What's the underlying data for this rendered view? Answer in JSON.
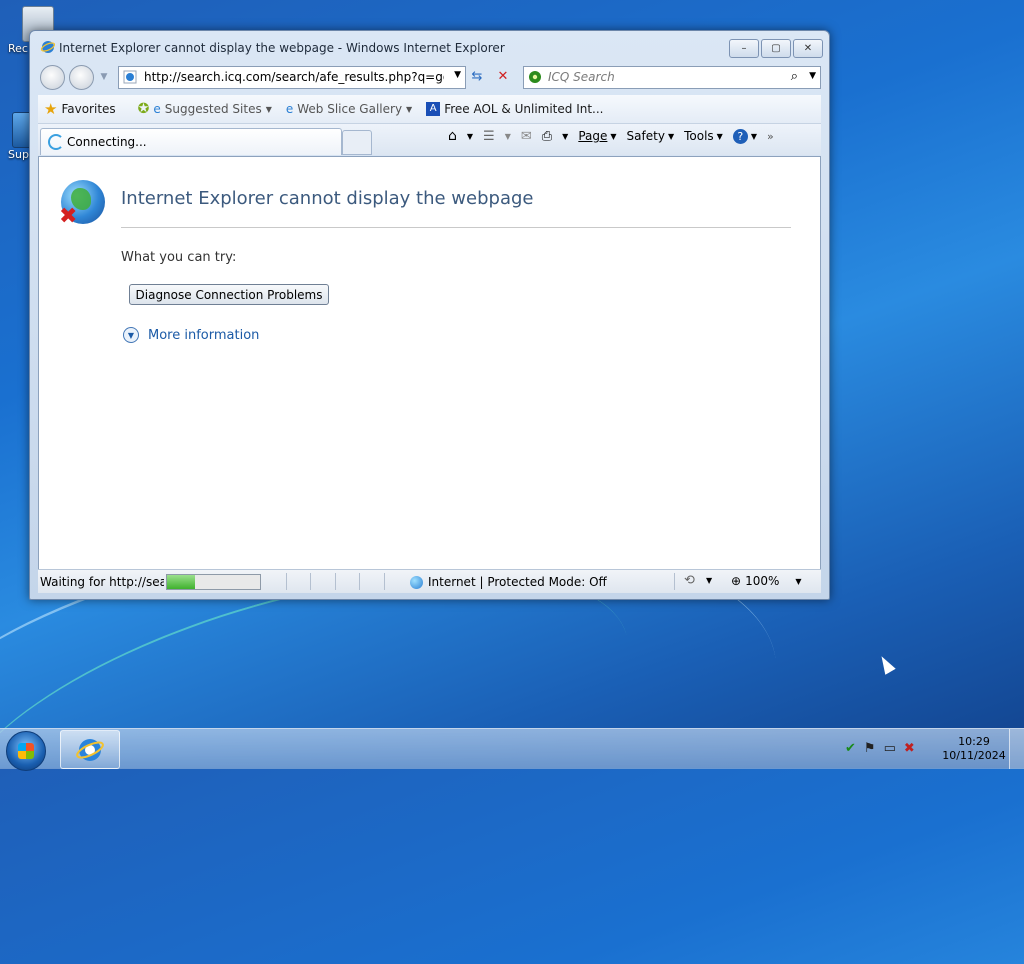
{
  "desktop": {
    "icons": [
      {
        "label": "Rec",
        "icon": "recycle-bin-icon"
      },
      {
        "label": "Sup",
        "icon": "shortcut-icon"
      }
    ]
  },
  "window": {
    "title": "Internet Explorer cannot display the webpage - Windows Internet Explorer",
    "caption": {
      "minimize": "–",
      "maximize": "▢",
      "close": "✕"
    }
  },
  "nav": {
    "address": "http://search.icq.com/search/afe_results.php?q=google.c",
    "search_placeholder": "ICQ Search"
  },
  "favorites_bar": {
    "favorites_label": "Favorites",
    "items": [
      "Suggested Sites",
      "Web Slice Gallery",
      "Free AOL & Unlimited Int..."
    ]
  },
  "tab": {
    "label": "Connecting..."
  },
  "command_bar": {
    "page": "Page",
    "safety": "Safety",
    "tools": "Tools"
  },
  "page": {
    "heading": "Internet Explorer cannot display the webpage",
    "what_you_can_try": "What you can try:",
    "diagnose_button": "Diagnose Connection Problems",
    "more_information": "More information"
  },
  "status": {
    "text": "Waiting for http://search.icq.com/",
    "progress": 0.3,
    "zone": "Internet | Protected Mode: Off",
    "zoom": "100%"
  },
  "taskbar": {
    "time": "10:29",
    "date": "10/11/2024"
  },
  "colors": {
    "accent_link": "#1b5aa6",
    "heading": "#3c5a7e",
    "progress": "#3fb12e"
  }
}
